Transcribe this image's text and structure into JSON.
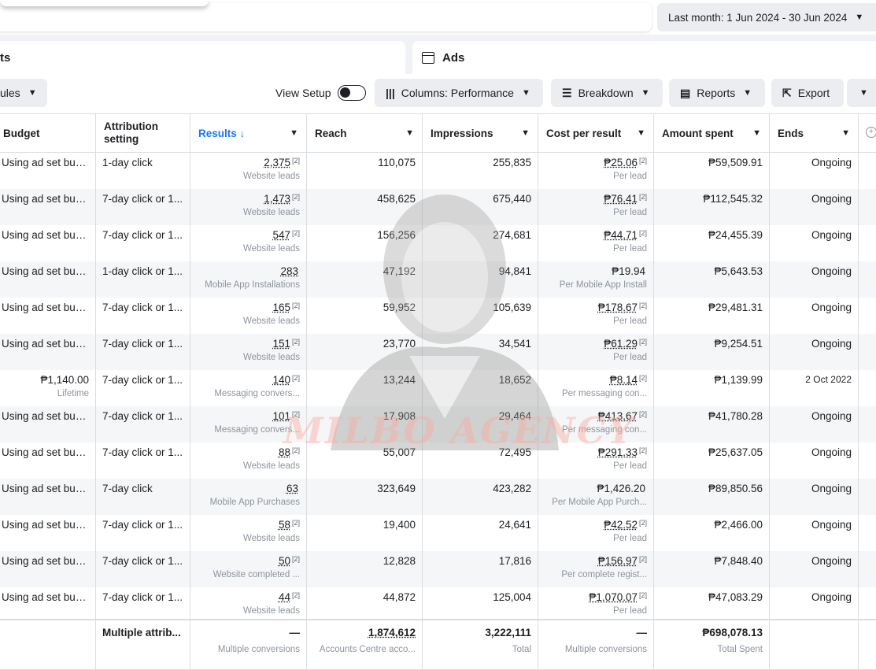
{
  "top": {
    "date_range": "Last month: 1 Jun 2024 - 30 Jun 2024"
  },
  "tabs": {
    "left_label": "ts",
    "ads_label": "Ads"
  },
  "toolbar": {
    "rules_label": "ules",
    "view_setup_label": "View Setup",
    "columns_label": "Columns: Performance",
    "breakdown_label": "Breakdown",
    "reports_label": "Reports",
    "export_label": "Export"
  },
  "table": {
    "headers": {
      "budget": "Budget",
      "attribution": "Attribution setting",
      "results": "Results ↓",
      "reach": "Reach",
      "impressions": "Impressions",
      "cost_per_result": "Cost per result",
      "amount_spent": "Amount spent",
      "ends": "Ends"
    },
    "rows": [
      {
        "budget": "Using ad set bud...",
        "budget_sub": "",
        "attribution": "1-day click",
        "results": "2,375",
        "results_fn": "[2]",
        "results_sub": "Website leads",
        "reach": "110,075",
        "impressions": "255,835",
        "cpr": "₱25.06",
        "cpr_fn": "[2]",
        "cpr_sub": "Per lead",
        "spent": "₱59,509.91",
        "ends": "Ongoing"
      },
      {
        "budget": "Using ad set bud...",
        "budget_sub": "",
        "attribution": "7-day click or 1...",
        "results": "1,473",
        "results_fn": "[2]",
        "results_sub": "Website leads",
        "reach": "458,625",
        "impressions": "675,440",
        "cpr": "₱76.41",
        "cpr_fn": "[2]",
        "cpr_sub": "Per lead",
        "spent": "₱112,545.32",
        "ends": "Ongoing"
      },
      {
        "budget": "Using ad set bud...",
        "budget_sub": "",
        "attribution": "7-day click or 1...",
        "results": "547",
        "results_fn": "[2]",
        "results_sub": "Website leads",
        "reach": "156,256",
        "impressions": "274,681",
        "cpr": "₱44.71",
        "cpr_fn": "[2]",
        "cpr_sub": "Per lead",
        "spent": "₱24,455.39",
        "ends": "Ongoing"
      },
      {
        "budget": "Using ad set bud...",
        "budget_sub": "",
        "attribution": "1-day click or 1...",
        "results": "283",
        "results_fn": "",
        "results_sub": "Mobile App Installations",
        "reach": "47,192",
        "impressions": "94,841",
        "cpr": "₱19.94",
        "cpr_fn": "",
        "cpr_sub": "Per Mobile App Install",
        "spent": "₱5,643.53",
        "ends": "Ongoing"
      },
      {
        "budget": "Using ad set bud...",
        "budget_sub": "",
        "attribution": "7-day click or 1...",
        "results": "165",
        "results_fn": "[2]",
        "results_sub": "Website leads",
        "reach": "59,952",
        "impressions": "105,639",
        "cpr": "₱178.67",
        "cpr_fn": "[2]",
        "cpr_sub": "Per lead",
        "spent": "₱29,481.31",
        "ends": "Ongoing"
      },
      {
        "budget": "Using ad set bud...",
        "budget_sub": "",
        "attribution": "7-day click or 1...",
        "results": "151",
        "results_fn": "[2]",
        "results_sub": "Website leads",
        "reach": "23,770",
        "impressions": "34,541",
        "cpr": "₱61.29",
        "cpr_fn": "[2]",
        "cpr_sub": "Per lead",
        "spent": "₱9,254.51",
        "ends": "Ongoing"
      },
      {
        "budget": "₱1,140.00",
        "budget_sub": "Lifetime",
        "attribution": "7-day click or 1...",
        "results": "140",
        "results_fn": "[2]",
        "results_sub": "Messaging convers...",
        "reach": "13,244",
        "impressions": "18,652",
        "cpr": "₱8.14",
        "cpr_fn": "[2]",
        "cpr_sub": "Per messaging con...",
        "spent": "₱1,139.99",
        "ends": "2 Oct 2022"
      },
      {
        "budget": "Using ad set bud...",
        "budget_sub": "",
        "attribution": "7-day click or 1...",
        "results": "101",
        "results_fn": "[2]",
        "results_sub": "Messaging convers...",
        "reach": "17,908",
        "impressions": "29,464",
        "cpr": "₱413.67",
        "cpr_fn": "[2]",
        "cpr_sub": "Per messaging con...",
        "spent": "₱41,780.28",
        "ends": "Ongoing"
      },
      {
        "budget": "Using ad set bud...",
        "budget_sub": "",
        "attribution": "7-day click or 1...",
        "results": "88",
        "results_fn": "[2]",
        "results_sub": "Website leads",
        "reach": "55,007",
        "impressions": "72,495",
        "cpr": "₱291.33",
        "cpr_fn": "[2]",
        "cpr_sub": "Per lead",
        "spent": "₱25,637.05",
        "ends": "Ongoing"
      },
      {
        "budget": "Using ad set bud...",
        "budget_sub": "",
        "attribution": "7-day click",
        "results": "63",
        "results_fn": "",
        "results_sub": "Mobile App Purchases",
        "reach": "323,649",
        "impressions": "423,282",
        "cpr": "₱1,426.20",
        "cpr_fn": "",
        "cpr_sub": "Per Mobile App Purch...",
        "spent": "₱89,850.56",
        "ends": "Ongoing"
      },
      {
        "budget": "Using ad set bud...",
        "budget_sub": "",
        "attribution": "7-day click or 1...",
        "results": "58",
        "results_fn": "[2]",
        "results_sub": "Website leads",
        "reach": "19,400",
        "impressions": "24,641",
        "cpr": "₱42.52",
        "cpr_fn": "[2]",
        "cpr_sub": "Per lead",
        "spent": "₱2,466.00",
        "ends": "Ongoing"
      },
      {
        "budget": "Using ad set bud...",
        "budget_sub": "",
        "attribution": "7-day click or 1...",
        "results": "50",
        "results_fn": "[2]",
        "results_sub": "Website completed ...",
        "reach": "12,828",
        "impressions": "17,816",
        "cpr": "₱156.97",
        "cpr_fn": "[2]",
        "cpr_sub": "Per complete regist...",
        "spent": "₱7,848.40",
        "ends": "Ongoing"
      },
      {
        "budget": "Using ad set bud...",
        "budget_sub": "",
        "attribution": "7-day click or 1...",
        "results": "44",
        "results_fn": "[2]",
        "results_sub": "Website leads",
        "reach": "44,872",
        "impressions": "125,004",
        "cpr": "₱1,070.07",
        "cpr_fn": "[2]",
        "cpr_sub": "Per lead",
        "spent": "₱47,083.29",
        "ends": "Ongoing"
      }
    ],
    "totals": {
      "attribution": "Multiple attrib...",
      "results": "—",
      "results_sub": "Multiple conversions",
      "reach": "1,874,612",
      "reach_sub": "Accounts Centre acco...",
      "impressions": "3,222,111",
      "impressions_sub": "Total",
      "cpr": "—",
      "cpr_sub": "Multiple conversions",
      "spent": "₱698,078.13",
      "spent_sub": "Total Spent"
    }
  },
  "watermark": {
    "text": "MILBO AGENCY"
  }
}
